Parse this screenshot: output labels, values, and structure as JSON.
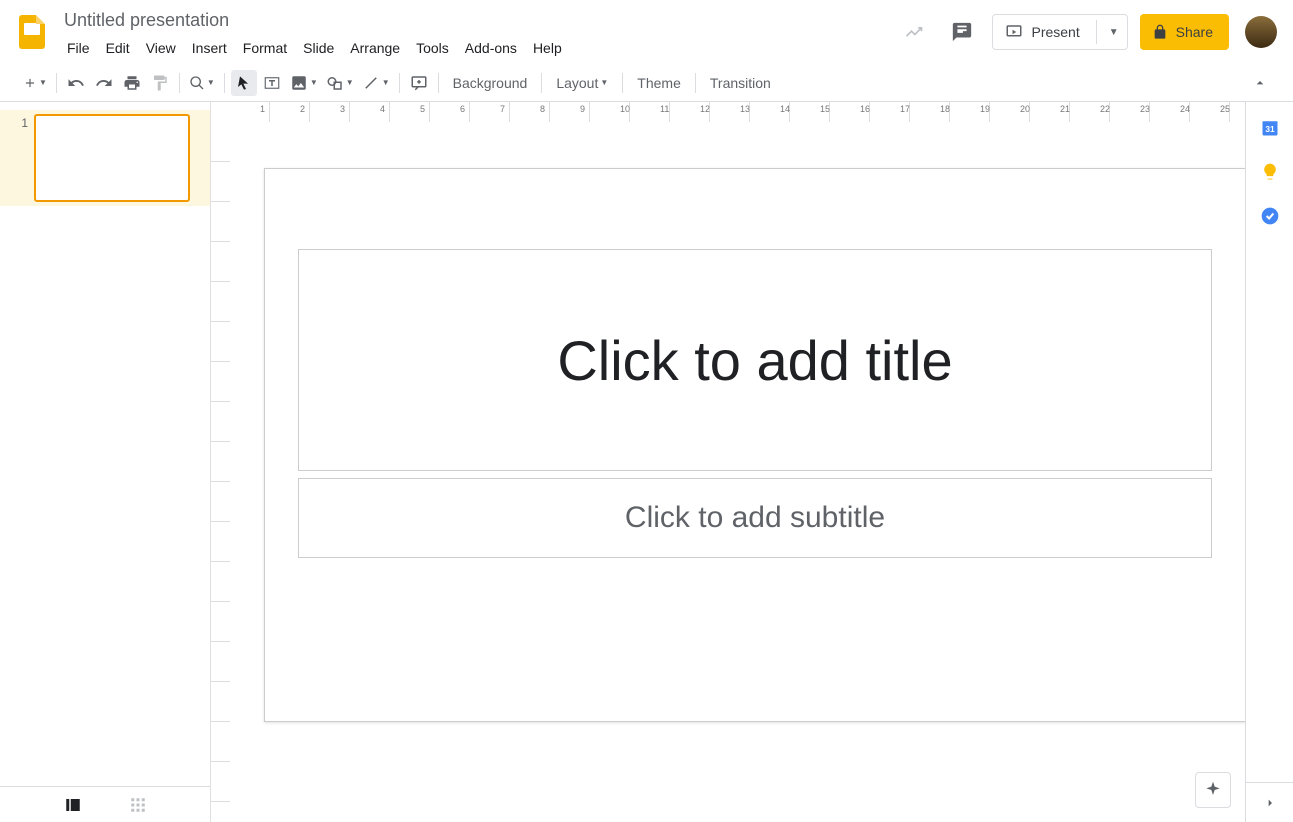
{
  "header": {
    "doc_title": "Untitled presentation",
    "present_label": "Present",
    "share_label": "Share"
  },
  "menus": [
    "File",
    "Edit",
    "View",
    "Insert",
    "Format",
    "Slide",
    "Arrange",
    "Tools",
    "Add-ons",
    "Help"
  ],
  "toolbar": {
    "background": "Background",
    "layout": "Layout",
    "theme": "Theme",
    "transition": "Transition"
  },
  "filmstrip": {
    "slides": [
      {
        "number": "1"
      }
    ]
  },
  "canvas": {
    "title_placeholder": "Click to add title",
    "subtitle_placeholder": "Click to add subtitle"
  },
  "ruler_marks": [
    1,
    2,
    3,
    4,
    5,
    6,
    7,
    8,
    9,
    10,
    11,
    12,
    13,
    14,
    15,
    16,
    17,
    18,
    19,
    20,
    21,
    22,
    23,
    24,
    25
  ],
  "side_apps": {
    "calendar": "calendar-icon",
    "keep": "keep-icon",
    "tasks": "tasks-icon"
  }
}
